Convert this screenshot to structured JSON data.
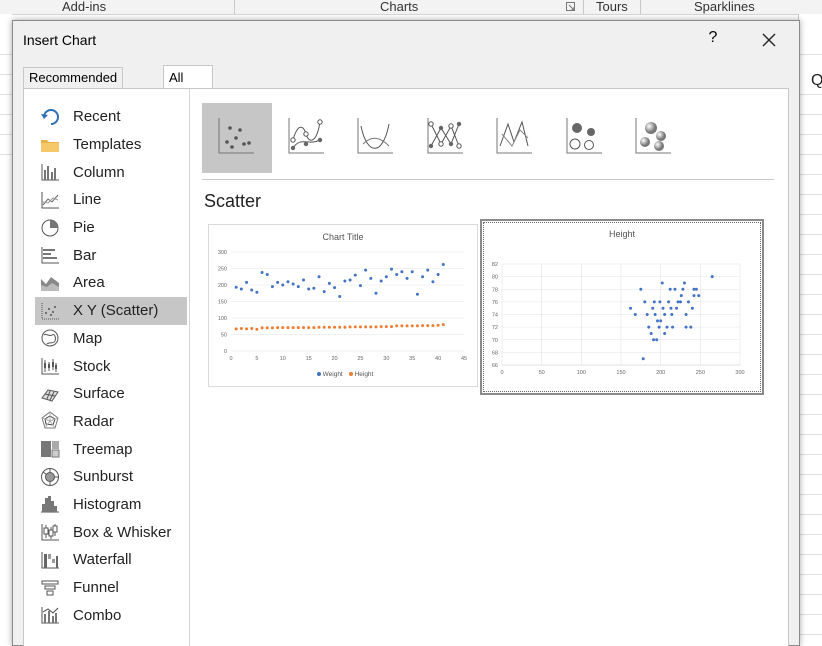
{
  "ribbon": {
    "groups": [
      "Add-ins",
      "Charts",
      "Tours",
      "Sparklines"
    ]
  },
  "sheet_partial_text": "Q",
  "dialog": {
    "title": "Insert Chart",
    "help": "?",
    "close": "✕",
    "tabs": [
      {
        "label": "Recommended Charts",
        "active": false
      },
      {
        "label": "All Charts",
        "active": true
      }
    ],
    "categories": [
      {
        "label": "Recent",
        "icon": "recent-icon"
      },
      {
        "label": "Templates",
        "icon": "folder-icon"
      },
      {
        "label": "Column",
        "icon": "column-chart-icon"
      },
      {
        "label": "Line",
        "icon": "line-chart-icon"
      },
      {
        "label": "Pie",
        "icon": "pie-chart-icon"
      },
      {
        "label": "Bar",
        "icon": "bar-chart-icon"
      },
      {
        "label": "Area",
        "icon": "area-chart-icon"
      },
      {
        "label": "X Y (Scatter)",
        "icon": "scatter-chart-icon",
        "selected": true
      },
      {
        "label": "Map",
        "icon": "map-chart-icon"
      },
      {
        "label": "Stock",
        "icon": "stock-chart-icon"
      },
      {
        "label": "Surface",
        "icon": "surface-chart-icon"
      },
      {
        "label": "Radar",
        "icon": "radar-chart-icon"
      },
      {
        "label": "Treemap",
        "icon": "treemap-chart-icon"
      },
      {
        "label": "Sunburst",
        "icon": "sunburst-chart-icon"
      },
      {
        "label": "Histogram",
        "icon": "histogram-chart-icon"
      },
      {
        "label": "Box & Whisker",
        "icon": "box-whisker-chart-icon"
      },
      {
        "label": "Waterfall",
        "icon": "waterfall-chart-icon"
      },
      {
        "label": "Funnel",
        "icon": "funnel-chart-icon"
      },
      {
        "label": "Combo",
        "icon": "combo-chart-icon"
      }
    ],
    "subtypes": [
      {
        "name": "scatter-subtype-icon",
        "selected": true
      },
      {
        "name": "scatter-smooth-lines-markers-subtype-icon"
      },
      {
        "name": "scatter-smooth-lines-subtype-icon"
      },
      {
        "name": "scatter-straight-lines-markers-subtype-icon"
      },
      {
        "name": "scatter-straight-lines-subtype-icon"
      },
      {
        "name": "bubble-subtype-icon"
      },
      {
        "name": "3d-bubble-subtype-icon"
      }
    ],
    "section_heading": "Scatter"
  },
  "chart_data": [
    {
      "type": "scatter",
      "title": "Chart Title",
      "xlim": [
        0,
        45
      ],
      "ylim": [
        0,
        300
      ],
      "xticks": [
        "0",
        "5",
        "10",
        "15",
        "20",
        "25",
        "30",
        "35",
        "40",
        "45"
      ],
      "yticks": [
        "0",
        "50",
        "100",
        "150",
        "200",
        "250",
        "300"
      ],
      "grid": true,
      "legend": "bottom",
      "series": [
        {
          "name": "Weight",
          "color": "#4472c4",
          "x": [
            1,
            2,
            3,
            4,
            5,
            6,
            7,
            8,
            9,
            10,
            11,
            12,
            13,
            14,
            15,
            16,
            17,
            18,
            19,
            20,
            21,
            22,
            23,
            24,
            25,
            26,
            27,
            28,
            29,
            30,
            31,
            32,
            33,
            34,
            35,
            36,
            37,
            38,
            39,
            40,
            41
          ],
          "y": [
            193,
            188,
            208,
            185,
            178,
            238,
            232,
            195,
            208,
            200,
            210,
            203,
            195,
            215,
            188,
            190,
            225,
            180,
            205,
            192,
            165,
            212,
            215,
            230,
            198,
            245,
            220,
            175,
            212,
            225,
            248,
            232,
            240,
            220,
            240,
            172,
            225,
            245,
            210,
            232,
            262
          ]
        },
        {
          "name": "Height",
          "color": "#ed7d31",
          "x": [
            1,
            2,
            3,
            4,
            5,
            6,
            7,
            8,
            9,
            10,
            11,
            12,
            13,
            14,
            15,
            16,
            17,
            18,
            19,
            20,
            21,
            22,
            23,
            24,
            25,
            26,
            27,
            28,
            29,
            30,
            31,
            32,
            33,
            34,
            35,
            36,
            37,
            38,
            39,
            40,
            41
          ],
          "y": [
            67,
            68,
            67,
            68,
            66,
            70,
            70,
            70,
            71,
            71,
            71,
            71,
            71,
            71,
            71,
            71,
            72,
            72,
            72,
            72,
            72,
            72,
            73,
            73,
            73,
            73,
            73,
            73,
            74,
            74,
            74,
            76,
            76,
            76,
            76,
            76,
            77,
            77,
            77,
            78,
            80
          ]
        }
      ]
    },
    {
      "type": "scatter",
      "title": "Height",
      "xlim": [
        0,
        300
      ],
      "ylim": [
        66,
        82
      ],
      "xticks": [
        "0",
        "50",
        "100",
        "150",
        "200",
        "250",
        "300"
      ],
      "yticks": [
        "66",
        "68",
        "70",
        "72",
        "74",
        "76",
        "78",
        "80",
        "82"
      ],
      "grid": true,
      "series": [
        {
          "color": "#4472c4",
          "x": [
            162,
            168,
            175,
            178,
            180,
            183,
            185,
            188,
            190,
            191,
            192,
            193,
            195,
            196,
            198,
            199,
            200,
            202,
            203,
            205,
            205,
            208,
            210,
            212,
            213,
            214,
            215,
            218,
            220,
            222,
            225,
            226,
            228,
            230,
            232,
            232,
            235,
            238,
            240,
            242,
            242,
            245,
            248,
            265
          ],
          "y": [
            75,
            74,
            78,
            67,
            76,
            74,
            72,
            71,
            75,
            70,
            76,
            74,
            70,
            73,
            72,
            76,
            73,
            79,
            75,
            74,
            71,
            72,
            76,
            78,
            75,
            74,
            72,
            78,
            75,
            76,
            76,
            77,
            78,
            79,
            72,
            74,
            76,
            72,
            75,
            77,
            78,
            78,
            77,
            80
          ]
        }
      ]
    }
  ]
}
